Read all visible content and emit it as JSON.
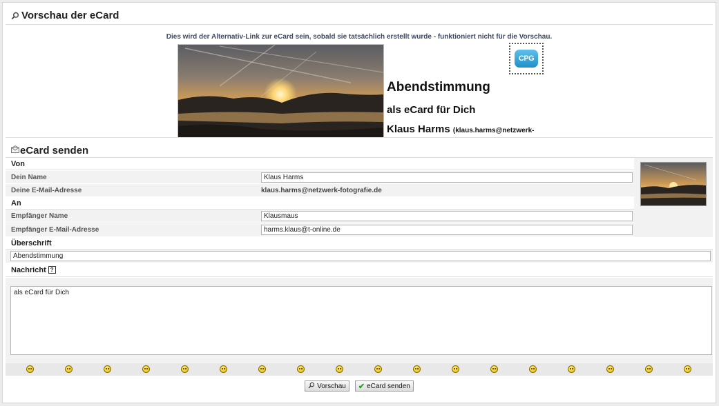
{
  "preview": {
    "title": "Vorschau der eCard",
    "alt_link_note": "Dies wird der Alternativ-Link zur eCard sein, sobald sie tatsächlich erstellt wurde - funktioniert nicht für die Vorschau.",
    "stamp_text": "CPG",
    "card_title": "Abendstimmung",
    "card_message": "als eCard für Dich",
    "sender_name": "Klaus Harms",
    "sender_email_fragment": "(klaus.harms@netzwerk-"
  },
  "send": {
    "title": "eCard senden",
    "from_header": "Von",
    "your_name_label": "Dein Name",
    "your_name_value": "Klaus Harms",
    "your_email_label": "Deine E-Mail-Adresse",
    "your_email_value": "klaus.harms@netzwerk-fotografie.de",
    "to_header": "An",
    "recipient_name_label": "Empfänger Name",
    "recipient_name_value": "Klausmaus",
    "recipient_email_label": "Empfänger E-Mail-Adresse",
    "recipient_email_value": "harms.klaus@t-online.de",
    "heading_label": "Überschrift",
    "heading_value": "Abendstimmung",
    "message_label": "Nachricht",
    "help_glyph": "?",
    "message_value": "als eCard für Dich",
    "smiley_count": 18
  },
  "buttons": {
    "preview_label": "Vorschau",
    "send_label": "eCard senden"
  },
  "icons": {
    "title_icon": "magnifier-icon",
    "send_icon": "envelope-icon",
    "preview_button_icon": "magnifier-icon",
    "send_button_icon": "checkmark-icon"
  },
  "colors": {
    "note_text": "#3c4a66",
    "label_bg": "#f2f2f2",
    "smiley_bar": "#e8e8e8"
  }
}
